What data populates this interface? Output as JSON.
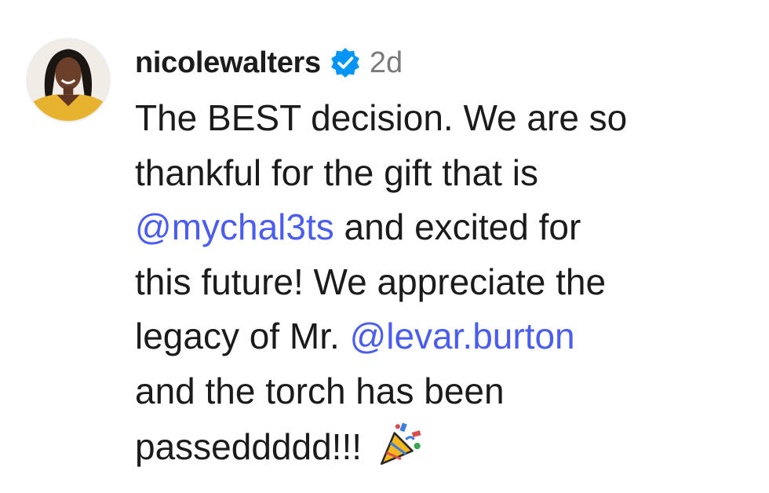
{
  "comment": {
    "username": "nicolewalters",
    "verified": true,
    "timestamp": "2d",
    "avatar_icon": "profile-photo",
    "verified_icon": "verified-badge-icon",
    "accent_color": "#0095f6",
    "mention_color": "#4a5df0",
    "lines": {
      "l1": "The BEST decision. We are so",
      "l2": "thankful for the gift that is",
      "l3_mention": "@mychal3ts",
      "l3_rest": " and excited for",
      "l4": "this future! We appreciate the",
      "l5_pre": "legacy of Mr. ",
      "l5_mention": "@levar.burton",
      "l6": "and the torch has been",
      "l7": "passeddddd!!! "
    },
    "emoji": "party-popper-icon"
  }
}
